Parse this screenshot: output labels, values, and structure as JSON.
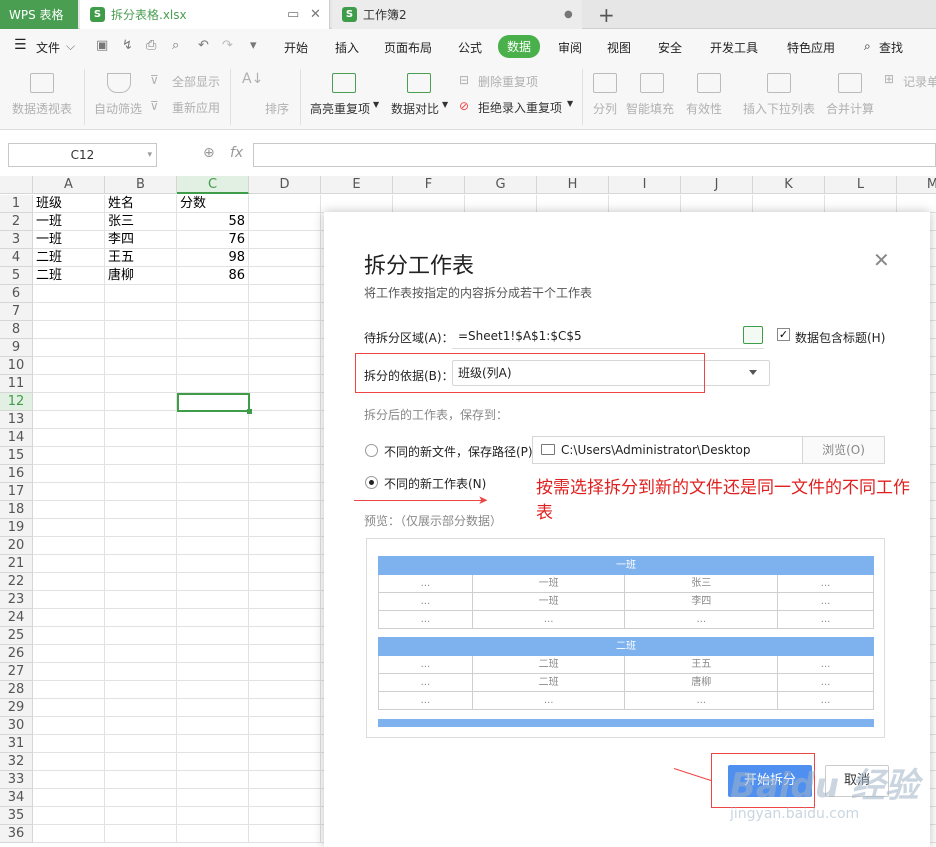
{
  "tabbar": {
    "app_tab": "WPS 表格",
    "file_tab_1": "拆分表格.xlsx",
    "file_tab_2": "工作簿2"
  },
  "menubar": {
    "file": "文件",
    "items": [
      "开始",
      "插入",
      "页面布局",
      "公式",
      "数据",
      "审阅",
      "视图",
      "安全",
      "开发工具",
      "特色应用",
      "查找"
    ],
    "active": "数据"
  },
  "ribbon": {
    "pivot": "数据透视表",
    "auto_filter": "自动筛选",
    "show_all": "全部显示",
    "reapply": "重新应用",
    "sort": "排序",
    "highlight_dup": "高亮重复项",
    "compare": "数据对比",
    "delete_dup": "删除重复项",
    "reject_dup": "拒绝录入重复项",
    "split": "分列",
    "smart_fill": "智能填充",
    "validity": "有效性",
    "insert_dropdown": "插入下拉列表",
    "consolidate": "合并计算",
    "record": "记录单"
  },
  "formula": {
    "name_box": "C12",
    "fx": "fx"
  },
  "sheet": {
    "columns": [
      "A",
      "B",
      "C",
      "D",
      "E",
      "F",
      "G",
      "H",
      "I",
      "J",
      "K",
      "L",
      "M"
    ],
    "rows": [
      "1",
      "2",
      "3",
      "4",
      "5",
      "6",
      "7",
      "8",
      "9",
      "10",
      "11",
      "12",
      "13",
      "14",
      "15",
      "16",
      "17",
      "18",
      "19",
      "20",
      "21",
      "22",
      "23",
      "24",
      "25",
      "26",
      "27",
      "28",
      "29",
      "30",
      "31",
      "32",
      "33",
      "34",
      "35",
      "36"
    ],
    "data": [
      [
        "班级",
        "姓名",
        "分数"
      ],
      [
        "一班",
        "张三",
        "58"
      ],
      [
        "一班",
        "李四",
        "76"
      ],
      [
        "二班",
        "王五",
        "98"
      ],
      [
        "二班",
        "唐柳",
        "86"
      ]
    ],
    "selected_column": "C",
    "selected_row": "12"
  },
  "dialog": {
    "title": "拆分工作表",
    "subtitle": "将工作表按指定的内容拆分成若干个工作表",
    "range_label": "待拆分区域(A)：",
    "range_value": "=Sheet1!$A$1:$C$5",
    "header_checkbox_label": "数据包含标题(H)",
    "header_checked": true,
    "basis_label": "拆分的依据(B)：",
    "basis_value": "班级(列A)",
    "save_to_label": "拆分后的工作表，保存到：",
    "option_new_file": "不同的新文件，保存路径(P)",
    "path_value": "C:\\Users\\Administrator\\Desktop",
    "browse": "浏览(O)",
    "option_new_sheet": "不同的新工作表(N)",
    "selected_option": "new_sheet",
    "preview_label": "预览：（仅展示部分数据）",
    "preview": [
      {
        "header": "一班",
        "rows": [
          [
            "...",
            "一班",
            "张三",
            "..."
          ],
          [
            "...",
            "一班",
            "李四",
            "..."
          ],
          [
            "...",
            "...",
            "...",
            "..."
          ]
        ]
      },
      {
        "header": "二班",
        "rows": [
          [
            "...",
            "二班",
            "王五",
            "..."
          ],
          [
            "...",
            "二班",
            "唐柳",
            "..."
          ],
          [
            "...",
            "...",
            "...",
            "..."
          ]
        ]
      }
    ],
    "start_button": "开始拆分",
    "cancel_button": "取消"
  },
  "annotation": {
    "text": "按需选择拆分到新的文件还是同一文件的不同工作表"
  },
  "watermark": {
    "logo": "Baidu 经验",
    "sub": "jingyan.baidu.com"
  },
  "colors": {
    "accent_green": "#4a9e52",
    "annotation_red": "#e02020",
    "preview_blue": "#7eb2ef",
    "button_blue": "#4f8ff0"
  }
}
